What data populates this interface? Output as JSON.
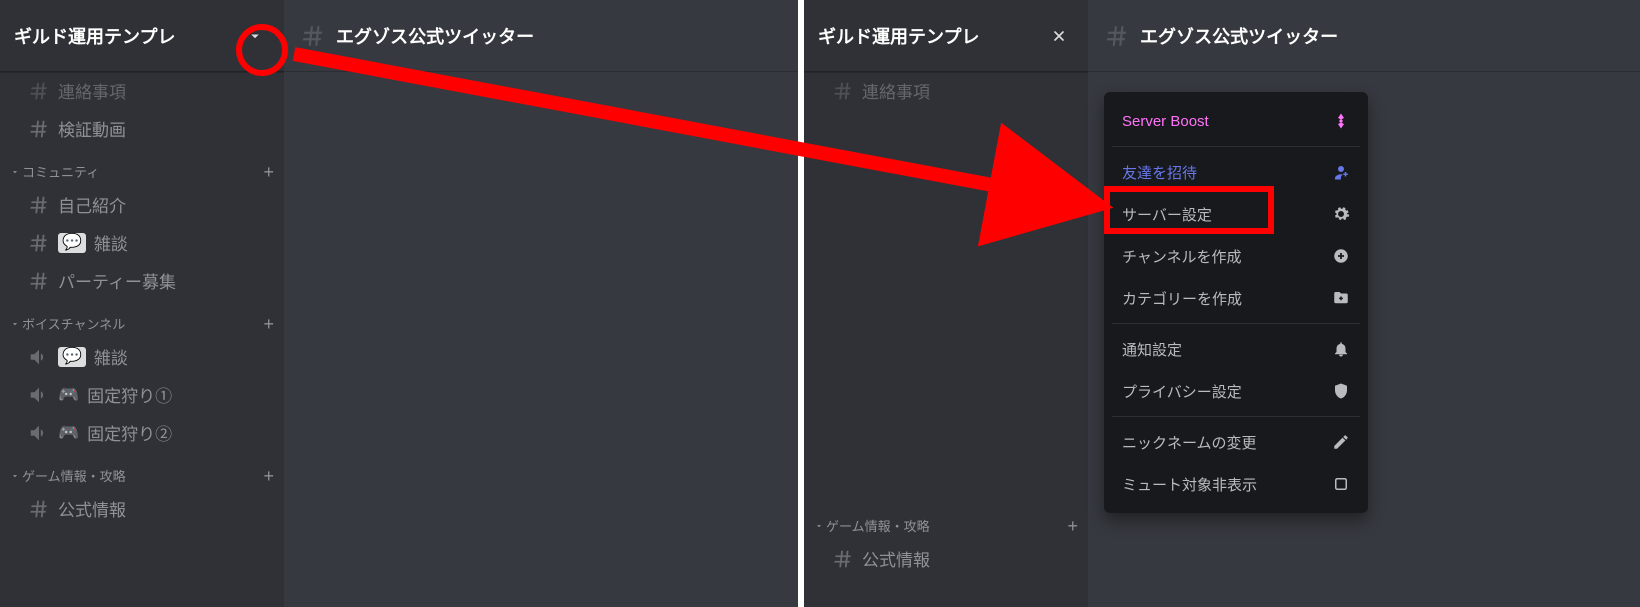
{
  "left": {
    "server_name": "ギルド運用テンプレ",
    "chat_title": "エグゾス公式ツイッター",
    "cutoff_channel": "連絡事項",
    "loose_channel": "検証動画",
    "categories": [
      {
        "name": "コミュニティ",
        "channels": [
          {
            "name": "自己紹介",
            "icon": "hash"
          },
          {
            "name": "雑談",
            "icon": "hash",
            "chip": true
          },
          {
            "name": "パーティー募集",
            "icon": "hash"
          }
        ]
      },
      {
        "name": "ボイスチャンネル",
        "channels": [
          {
            "name": "雑談",
            "icon": "speaker",
            "chip": true
          },
          {
            "name": "固定狩り①",
            "icon": "speaker",
            "pad": true
          },
          {
            "name": "固定狩り②",
            "icon": "speaker",
            "pad": true
          }
        ]
      },
      {
        "name": "ゲーム情報・攻略",
        "channels": [
          {
            "name": "公式情報",
            "icon": "hash"
          }
        ]
      }
    ]
  },
  "right": {
    "server_name": "ギルド運用テンプレ",
    "chat_title": "エグゾス公式ツイッター",
    "cutoff_channel": "連絡事項",
    "category_tail": {
      "name": "ゲーム情報・攻略",
      "channels": [
        {
          "name": "公式情報",
          "icon": "hash"
        }
      ]
    },
    "menu": [
      {
        "label": "Server Boost",
        "icon": "boost",
        "cls": "boost"
      },
      {
        "sep": true
      },
      {
        "label": "友達を招待",
        "icon": "invite",
        "cls": "invite"
      },
      {
        "label": "サーバー設定",
        "icon": "gear",
        "highlight": true
      },
      {
        "label": "チャンネルを作成",
        "icon": "plus-circle"
      },
      {
        "label": "カテゴリーを作成",
        "icon": "folder-plus"
      },
      {
        "sep": true
      },
      {
        "label": "通知設定",
        "icon": "bell"
      },
      {
        "label": "プライバシー設定",
        "icon": "shield"
      },
      {
        "sep": true
      },
      {
        "label": "ニックネームの変更",
        "icon": "pencil"
      },
      {
        "label": "ミュート対象非表示",
        "icon": "square"
      }
    ]
  },
  "speech_glyph": "💬",
  "pad_glyph": "🎮"
}
